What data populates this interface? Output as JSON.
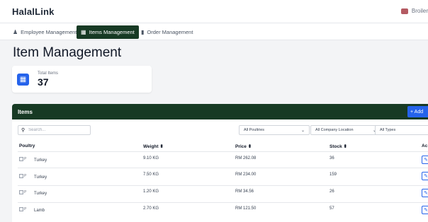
{
  "app": {
    "logo": "HalalLink",
    "user_name": "Broiler"
  },
  "nav": {
    "tabs": [
      {
        "label": "Employee Management",
        "icon": "users-icon",
        "active": false
      },
      {
        "label": "Items Management",
        "icon": "boxes-icon",
        "active": true
      },
      {
        "label": "Order Management",
        "icon": "clipboard-icon",
        "active": false
      }
    ]
  },
  "page": {
    "title": "Item Management"
  },
  "stats": {
    "total_items_label": "Total Items",
    "total_items_value": "37"
  },
  "items_panel": {
    "title": "Items",
    "add_button_label": "+ Add",
    "search_placeholder": "Search...",
    "filters": {
      "poultries": "All Poultries",
      "company_location": "All Company Location",
      "types": "All Types"
    },
    "columns": [
      "Poultry",
      "Weight ⬍",
      "Price ⬍",
      "Stock ⬍",
      "Ac"
    ],
    "rows": [
      {
        "image_alt": "P",
        "poultry": "Turkey",
        "weight": "9.10 KG",
        "price": "RM 262.08",
        "stock": "36"
      },
      {
        "image_alt": "P",
        "poultry": "Turkey",
        "weight": "7.50 KG",
        "price": "RM 234.00",
        "stock": "159"
      },
      {
        "image_alt": "P",
        "poultry": "Turkey",
        "weight": "1.20 KG",
        "price": "RM 34.56",
        "stock": "26"
      },
      {
        "image_alt": "P",
        "poultry": "Lamb",
        "weight": "2.70 KG",
        "price": "RM 121.50",
        "stock": "57"
      }
    ]
  },
  "colors": {
    "header_green": "#173a24",
    "accent_blue": "#2563eb"
  }
}
